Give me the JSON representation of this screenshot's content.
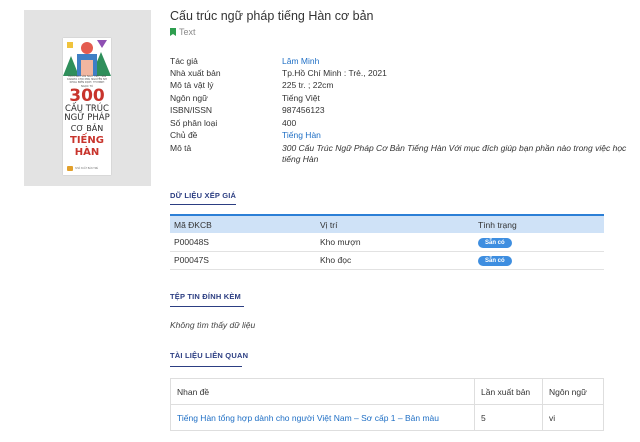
{
  "record": {
    "title": "Cấu trúc ngữ pháp tiếng Hàn cơ bản",
    "type_label": "Text"
  },
  "cover": {
    "subtitle": "TRƯỜNG HÀN NGỮ VIỆT HÀN KANATA CHO MIN, NGUYỄN NH KHOA BIÊN DỊCH: TH MINH NGỌC TÚ",
    "number": "300",
    "line1": "CẤU TRÚC",
    "line2": "NGỮ PHÁP",
    "line3": "CƠ BẢN",
    "line4": "TIẾNG HÀN",
    "publisher": "NHÀ XUẤT BẢN TRẺ"
  },
  "metadata": [
    {
      "label": "Tác giả",
      "value": "Lâm Minh",
      "link": true
    },
    {
      "label": "Nhà xuất bản",
      "value": "Tp.Hồ Chí Minh : Trẻ., 2021",
      "link": false
    },
    {
      "label": "Mô tả vật lý",
      "value": "225 tr. ; 22cm",
      "link": false
    },
    {
      "label": "Ngôn ngữ",
      "value": "Tiếng Việt",
      "link": false
    },
    {
      "label": "ISBN/ISSN",
      "value": "987456123",
      "link": false
    },
    {
      "label": "Số phân loại",
      "value": "400",
      "link": false
    },
    {
      "label": "Chủ đề",
      "value": "Tiếng Hàn",
      "link": true
    },
    {
      "label": "Mô tả",
      "value": "300 Cấu Trúc Ngữ Pháp Cơ Bản Tiếng Hàn Với mục đích giúp bạn phần nào trong việc học tiếng Hàn",
      "link": false
    }
  ],
  "holdings": {
    "section_title": "DỮ LIỆU XẾP GIÁ",
    "columns": [
      "Mã ĐKCB",
      "Vị trí",
      "Tình trạng"
    ],
    "rows": [
      {
        "code": "P00048S",
        "location": "Kho mượn",
        "status": "Sẵn có"
      },
      {
        "code": "P00047S",
        "location": "Kho đọc",
        "status": "Sẵn có"
      }
    ]
  },
  "attachments": {
    "section_title": "TỆP TIN ĐÍNH KÈM",
    "empty_text": "Không tìm thấy dữ liệu"
  },
  "related": {
    "section_title": "TÀI LIỆU LIÊN QUAN",
    "columns": [
      "Nhan đề",
      "Lần xuất bản",
      "Ngôn ngữ"
    ],
    "rows": [
      {
        "title": "Tiếng Hàn tổng hợp dành cho người Việt Nam – Sơ cấp 1 – Bản màu",
        "edition": "5",
        "language": "vi"
      }
    ]
  },
  "colors": {
    "link": "#1f6fc5",
    "section": "#2c3e82",
    "badge": "#3e8ee0",
    "table_header": "#cfe2f7",
    "bookmark": "#2e9e4f"
  }
}
